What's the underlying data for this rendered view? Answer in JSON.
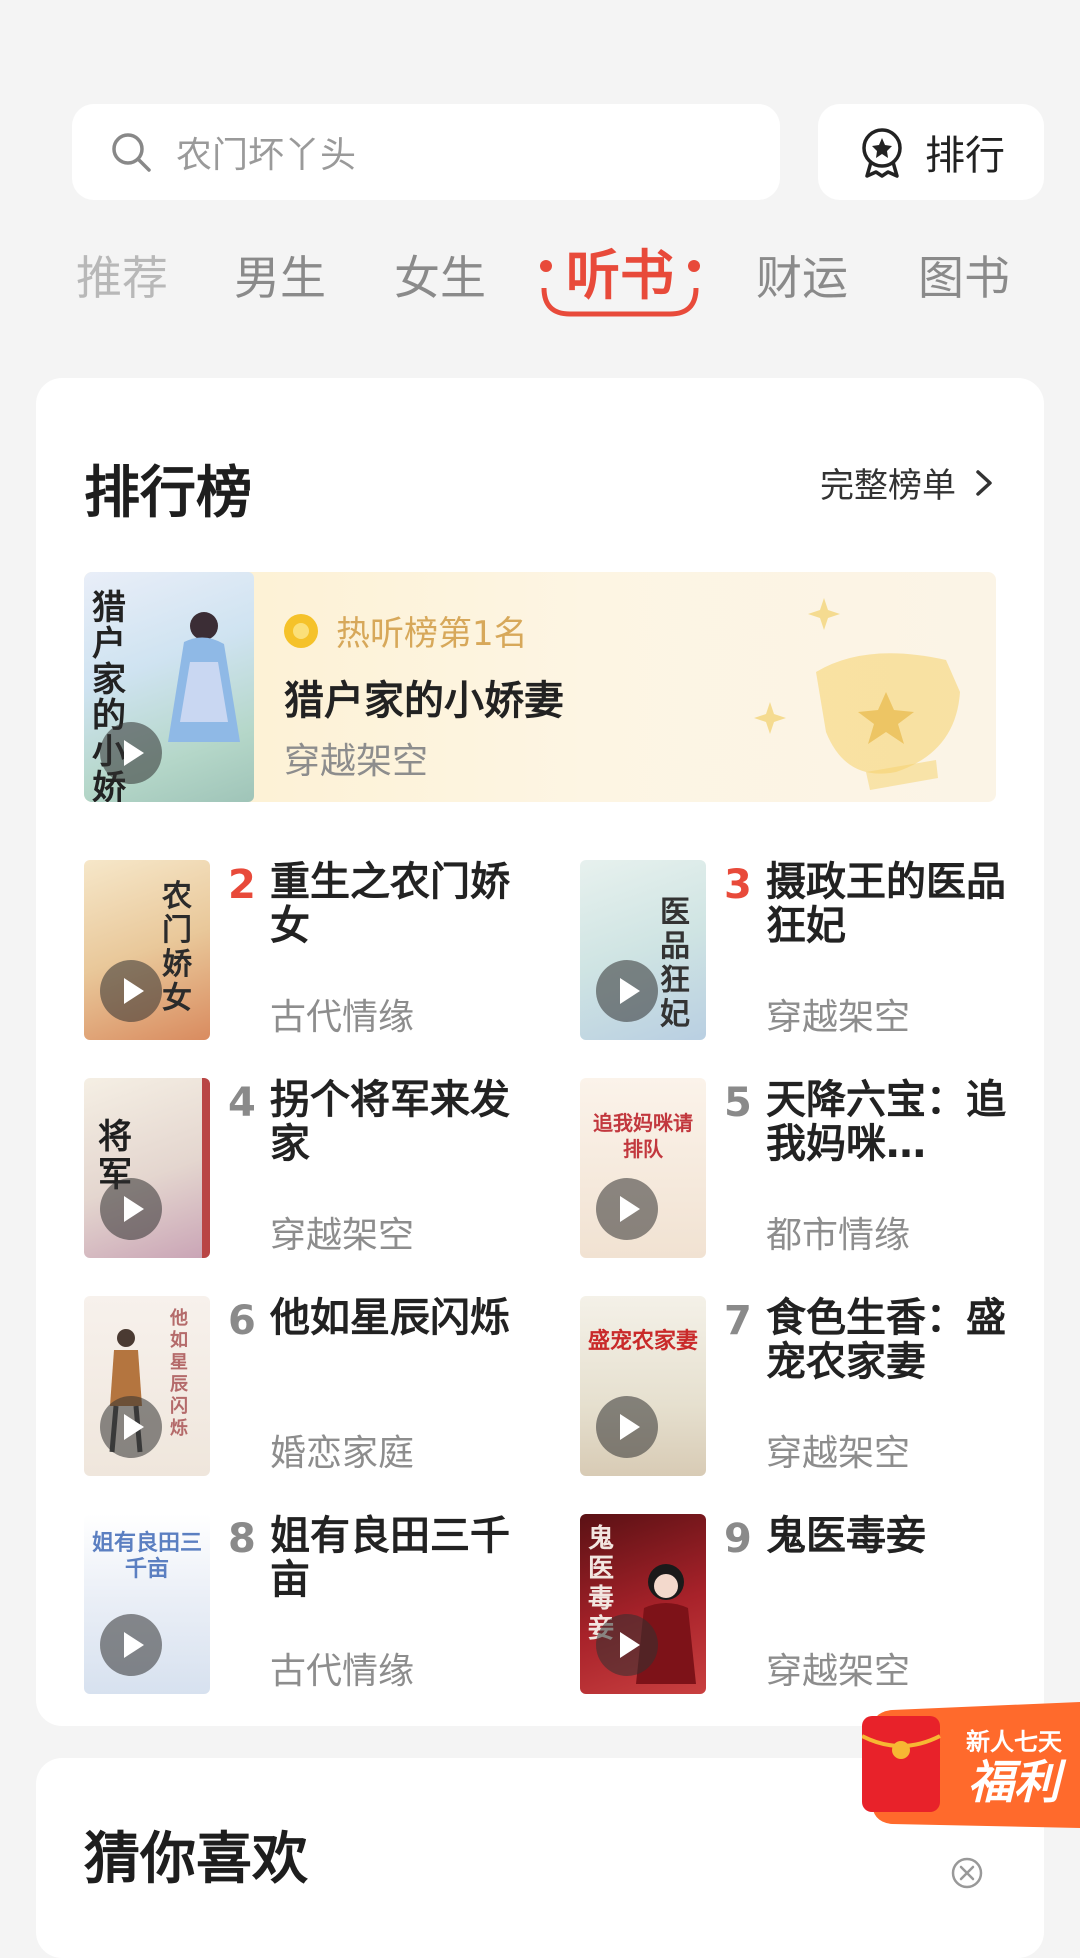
{
  "search": {
    "placeholder": "农门坏丫头"
  },
  "rank_button": {
    "label": "排行"
  },
  "tabs": [
    {
      "label": "推荐"
    },
    {
      "label": "男生"
    },
    {
      "label": "女生"
    },
    {
      "label": "听书",
      "active": true
    },
    {
      "label": "财运"
    },
    {
      "label": "图书"
    }
  ],
  "ranking": {
    "title": "排行榜",
    "full_list_label": "完整榜单",
    "top1": {
      "badge": "热听榜第1名",
      "title": "猎户家的小娇妻",
      "genre": "穿越架空",
      "cover_text": "猎户家的小娇妻"
    },
    "items": [
      {
        "rank": "2",
        "title": "重生之农门娇女",
        "genre": "古代情缘",
        "cover_text": "农门娇女"
      },
      {
        "rank": "3",
        "title": "摄政王的医品狂妃",
        "genre": "穿越架空",
        "cover_text": "医品狂妃"
      },
      {
        "rank": "4",
        "title": "拐个将军来发家",
        "genre": "穿越架空",
        "cover_text": "将军"
      },
      {
        "rank": "5",
        "title": "天降六宝：追我妈咪…",
        "genre": "都市情缘",
        "cover_text": "追我妈咪请排队"
      },
      {
        "rank": "6",
        "title": "他如星辰闪烁",
        "genre": "婚恋家庭",
        "cover_text": "他如星辰闪烁"
      },
      {
        "rank": "7",
        "title": "食色生香：盛宠农家妻",
        "genre": "穿越架空",
        "cover_text": "盛宠农家妻"
      },
      {
        "rank": "8",
        "title": "姐有良田三千亩",
        "genre": "古代情缘",
        "cover_text": "姐有良田三千亩"
      },
      {
        "rank": "9",
        "title": "鬼医毒妾",
        "genre": "穿越架空",
        "cover_text": "鬼医毒妾"
      }
    ]
  },
  "welfare": {
    "line1": "新人七天",
    "line2": "福利"
  },
  "guess": {
    "title": "猜你喜欢"
  },
  "colors": {
    "accent_red": "#e84a3a",
    "gold": "#d7a85a"
  }
}
